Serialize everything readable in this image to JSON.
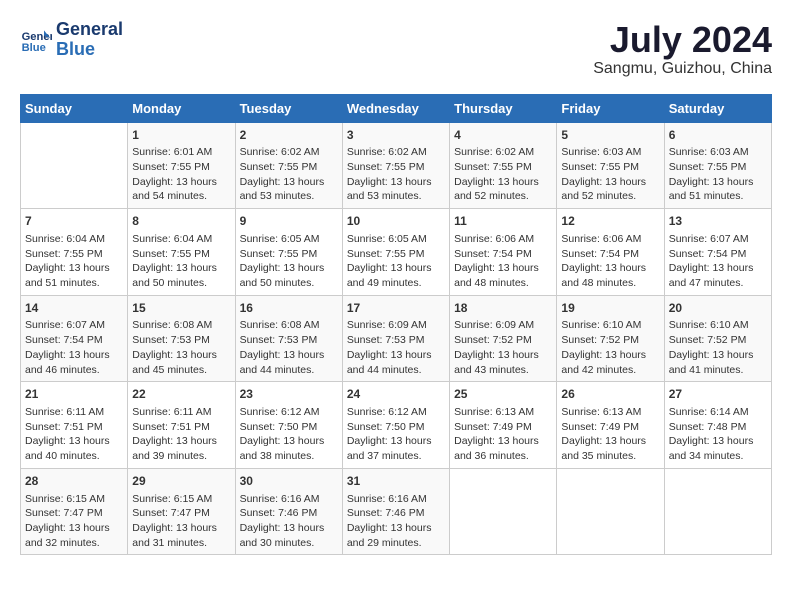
{
  "header": {
    "logo_line1": "General",
    "logo_line2": "Blue",
    "month_year": "July 2024",
    "location": "Sangmu, Guizhou, China"
  },
  "days_of_week": [
    "Sunday",
    "Monday",
    "Tuesday",
    "Wednesday",
    "Thursday",
    "Friday",
    "Saturday"
  ],
  "weeks": [
    [
      {
        "day": "",
        "empty": true
      },
      {
        "day": "1",
        "sunrise": "6:01 AM",
        "sunset": "7:55 PM",
        "daylight": "13 hours and 54 minutes."
      },
      {
        "day": "2",
        "sunrise": "6:02 AM",
        "sunset": "7:55 PM",
        "daylight": "13 hours and 53 minutes."
      },
      {
        "day": "3",
        "sunrise": "6:02 AM",
        "sunset": "7:55 PM",
        "daylight": "13 hours and 53 minutes."
      },
      {
        "day": "4",
        "sunrise": "6:02 AM",
        "sunset": "7:55 PM",
        "daylight": "13 hours and 52 minutes."
      },
      {
        "day": "5",
        "sunrise": "6:03 AM",
        "sunset": "7:55 PM",
        "daylight": "13 hours and 52 minutes."
      },
      {
        "day": "6",
        "sunrise": "6:03 AM",
        "sunset": "7:55 PM",
        "daylight": "13 hours and 51 minutes."
      }
    ],
    [
      {
        "day": "7",
        "sunrise": "6:04 AM",
        "sunset": "7:55 PM",
        "daylight": "13 hours and 51 minutes."
      },
      {
        "day": "8",
        "sunrise": "6:04 AM",
        "sunset": "7:55 PM",
        "daylight": "13 hours and 50 minutes."
      },
      {
        "day": "9",
        "sunrise": "6:05 AM",
        "sunset": "7:55 PM",
        "daylight": "13 hours and 50 minutes."
      },
      {
        "day": "10",
        "sunrise": "6:05 AM",
        "sunset": "7:55 PM",
        "daylight": "13 hours and 49 minutes."
      },
      {
        "day": "11",
        "sunrise": "6:06 AM",
        "sunset": "7:54 PM",
        "daylight": "13 hours and 48 minutes."
      },
      {
        "day": "12",
        "sunrise": "6:06 AM",
        "sunset": "7:54 PM",
        "daylight": "13 hours and 48 minutes."
      },
      {
        "day": "13",
        "sunrise": "6:07 AM",
        "sunset": "7:54 PM",
        "daylight": "13 hours and 47 minutes."
      }
    ],
    [
      {
        "day": "14",
        "sunrise": "6:07 AM",
        "sunset": "7:54 PM",
        "daylight": "13 hours and 46 minutes."
      },
      {
        "day": "15",
        "sunrise": "6:08 AM",
        "sunset": "7:53 PM",
        "daylight": "13 hours and 45 minutes."
      },
      {
        "day": "16",
        "sunrise": "6:08 AM",
        "sunset": "7:53 PM",
        "daylight": "13 hours and 44 minutes."
      },
      {
        "day": "17",
        "sunrise": "6:09 AM",
        "sunset": "7:53 PM",
        "daylight": "13 hours and 44 minutes."
      },
      {
        "day": "18",
        "sunrise": "6:09 AM",
        "sunset": "7:52 PM",
        "daylight": "13 hours and 43 minutes."
      },
      {
        "day": "19",
        "sunrise": "6:10 AM",
        "sunset": "7:52 PM",
        "daylight": "13 hours and 42 minutes."
      },
      {
        "day": "20",
        "sunrise": "6:10 AM",
        "sunset": "7:52 PM",
        "daylight": "13 hours and 41 minutes."
      }
    ],
    [
      {
        "day": "21",
        "sunrise": "6:11 AM",
        "sunset": "7:51 PM",
        "daylight": "13 hours and 40 minutes."
      },
      {
        "day": "22",
        "sunrise": "6:11 AM",
        "sunset": "7:51 PM",
        "daylight": "13 hours and 39 minutes."
      },
      {
        "day": "23",
        "sunrise": "6:12 AM",
        "sunset": "7:50 PM",
        "daylight": "13 hours and 38 minutes."
      },
      {
        "day": "24",
        "sunrise": "6:12 AM",
        "sunset": "7:50 PM",
        "daylight": "13 hours and 37 minutes."
      },
      {
        "day": "25",
        "sunrise": "6:13 AM",
        "sunset": "7:49 PM",
        "daylight": "13 hours and 36 minutes."
      },
      {
        "day": "26",
        "sunrise": "6:13 AM",
        "sunset": "7:49 PM",
        "daylight": "13 hours and 35 minutes."
      },
      {
        "day": "27",
        "sunrise": "6:14 AM",
        "sunset": "7:48 PM",
        "daylight": "13 hours and 34 minutes."
      }
    ],
    [
      {
        "day": "28",
        "sunrise": "6:15 AM",
        "sunset": "7:47 PM",
        "daylight": "13 hours and 32 minutes."
      },
      {
        "day": "29",
        "sunrise": "6:15 AM",
        "sunset": "7:47 PM",
        "daylight": "13 hours and 31 minutes."
      },
      {
        "day": "30",
        "sunrise": "6:16 AM",
        "sunset": "7:46 PM",
        "daylight": "13 hours and 30 minutes."
      },
      {
        "day": "31",
        "sunrise": "6:16 AM",
        "sunset": "7:46 PM",
        "daylight": "13 hours and 29 minutes."
      },
      {
        "day": "",
        "empty": true
      },
      {
        "day": "",
        "empty": true
      },
      {
        "day": "",
        "empty": true
      }
    ]
  ],
  "labels": {
    "sunrise_label": "Sunrise:",
    "sunset_label": "Sunset:",
    "daylight_label": "Daylight:"
  }
}
